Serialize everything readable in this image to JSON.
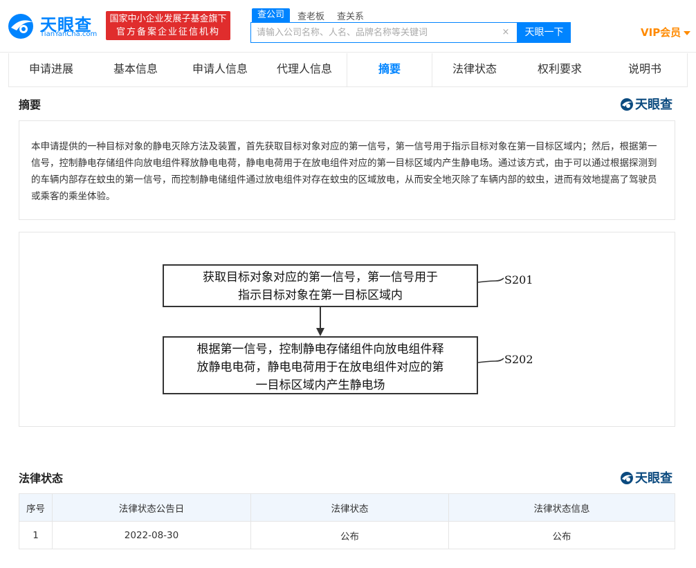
{
  "header": {
    "logo_name": "天眼查",
    "logo_domain": "TianYanCha.com",
    "banner_line1": "国家中小企业发展子基金旗下",
    "banner_line2": "官方备案企业征信机构",
    "search_tabs": [
      "查公司",
      "查老板",
      "查关系"
    ],
    "search_placeholder": "请输入公司名称、人名、品牌名称等关键词",
    "search_button": "天眼一下",
    "vip_label": "VIP会员"
  },
  "tabs": [
    "申请进展",
    "基本信息",
    "申请人信息",
    "代理人信息",
    "摘要",
    "法律状态",
    "权利要求",
    "说明书"
  ],
  "active_tab": "摘要",
  "abstract": {
    "title": "摘要",
    "watermark": "天眼查",
    "text": "本申请提供的一种目标对象的静电灭除方法及装置，首先获取目标对象对应的第一信号，第一信号用于指示目标对象在第一目标区域内；然后，根据第一信号，控制静电存储组件向放电组件释放静电电荷，静电电荷用于在放电组件对应的第一目标区域内产生静电场。通过该方式，由于可以通过根据探测到的车辆内部存在蚊虫的第一信号，而控制静电储组件通过放电组件对存在蚊虫的区域放电，从而安全地灭除了车辆内部的蚊虫，进而有效地提高了驾驶员或乘客的乘坐体验。"
  },
  "figure": {
    "step1_line1": "获取目标对象对应的第一信号，第一信号用于",
    "step1_line2": "指示目标对象在第一目标区域内",
    "step1_label": "S201",
    "step2_line1": "根据第一信号，控制静电存储组件向放电组件释",
    "step2_line2": "放静电电荷，静电电荷用于在放电组件对应的第",
    "step2_line3": "一目标区域内产生静电场",
    "step2_label": "S202"
  },
  "legal": {
    "title": "法律状态",
    "watermark": "天眼查",
    "columns": [
      "序号",
      "法律状态公告日",
      "法律状态",
      "法律状态信息"
    ],
    "rows": [
      [
        "1",
        "2022-08-30",
        "公布",
        "公布"
      ]
    ]
  },
  "colors": {
    "brand_blue": "#0084ff",
    "banner_red": "#e02d2d",
    "vip_orange": "#ff8a00",
    "table_header_bg": "#f0f6fd"
  }
}
